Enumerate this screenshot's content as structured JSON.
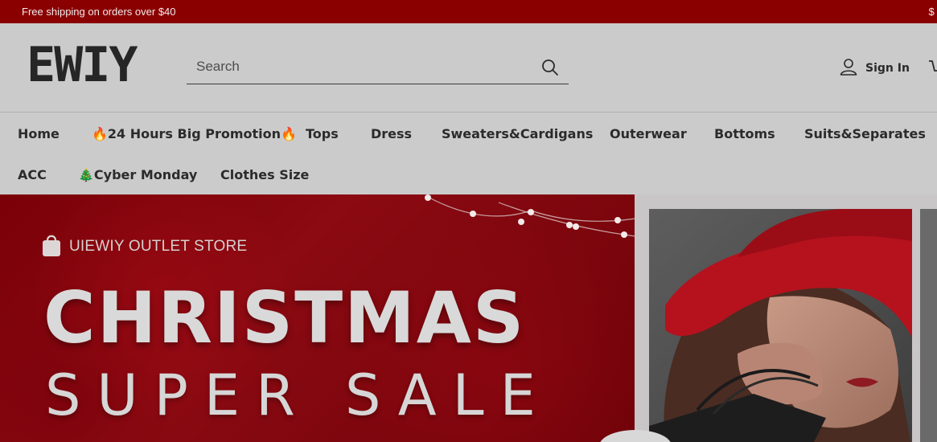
{
  "announcement": {
    "text": "Free shipping on orders over $40",
    "text_right": "$ t"
  },
  "header": {
    "logo": "EWIY",
    "search_placeholder": "Search",
    "sign_in": "Sign In"
  },
  "nav": {
    "items": [
      "Home",
      "🔥24 Hours Big Promotion🔥",
      "Tops",
      "Dress",
      "Sweaters&Cardigans",
      "Outerwear",
      "Bottoms",
      "Suits&Separates",
      "ACC",
      "🎄Cyber Monday",
      "Clothes Size"
    ]
  },
  "hero": {
    "store_label": "UIEWIY OUTLET STORE",
    "headline": "CHRISTMAS",
    "subheadline": "SUPER SALE"
  },
  "colors": {
    "announcement_bg": "#8a0000",
    "hero_red": "#8c0a12",
    "header_bg": "#cbcbcb"
  },
  "icons": [
    "search-icon",
    "user-icon",
    "cart-icon",
    "shopping-bag-icon"
  ]
}
